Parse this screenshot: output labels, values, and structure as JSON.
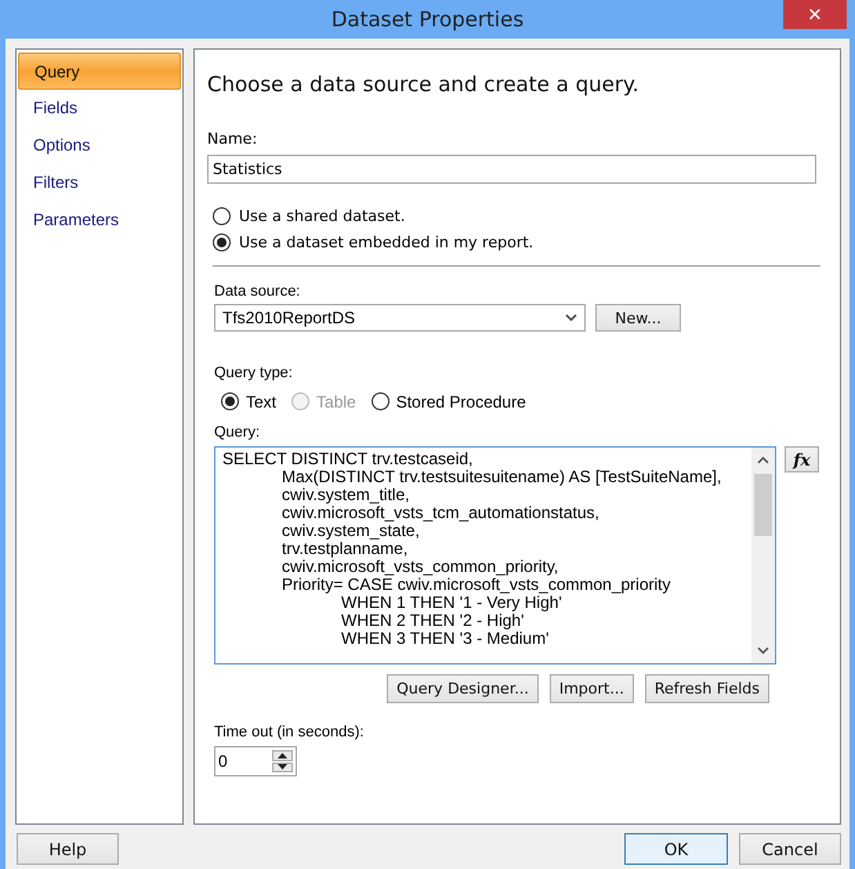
{
  "window": {
    "title": "Dataset Properties",
    "close": "✕"
  },
  "sidebar": {
    "items": [
      {
        "label": "Query",
        "selected": true
      },
      {
        "label": "Fields",
        "selected": false
      },
      {
        "label": "Options",
        "selected": false
      },
      {
        "label": "Filters",
        "selected": false
      },
      {
        "label": "Parameters",
        "selected": false
      }
    ]
  },
  "heading": "Choose a data source and create a query.",
  "name": {
    "label": "Name:",
    "value": "Statistics"
  },
  "dataset_options": [
    {
      "label": "Use a shared dataset.",
      "selected": false
    },
    {
      "label": "Use a dataset embedded in my report.",
      "selected": true
    }
  ],
  "data_source": {
    "label": "Data source:",
    "value": "Tfs2010ReportDS",
    "new_button": "New..."
  },
  "query_type": {
    "label": "Query type:",
    "options": [
      {
        "label": "Text",
        "selected": true,
        "disabled": false
      },
      {
        "label": "Table",
        "selected": false,
        "disabled": true
      },
      {
        "label": "Stored Procedure",
        "selected": false,
        "disabled": false
      }
    ]
  },
  "query": {
    "label": "Query:",
    "lines": [
      "SELECT DISTINCT trv.testcaseid,",
      "\tMax(DISTINCT trv.testsuitesuitename) AS [TestSuiteName],",
      "\tcwiv.system_title,",
      "\tcwiv.microsoft_vsts_tcm_automationstatus,",
      "\tcwiv.system_state,",
      "\ttrv.testplanname,",
      "\tcwiv.microsoft_vsts_common_priority,",
      "\tPriority= CASE cwiv.microsoft_vsts_common_priority",
      "\t\tWHEN 1 THEN '1 - Very High'",
      "\t\tWHEN 2 THEN '2 - High'",
      "\t\tWHEN 3 THEN '3 - Medium'"
    ],
    "fx_button": "fx"
  },
  "query_buttons": [
    "Query Designer...",
    "Import...",
    "Refresh Fields"
  ],
  "timeout": {
    "label": "Time out (in seconds):",
    "value": "0"
  },
  "footer": {
    "help": "Help",
    "ok": "OK",
    "cancel": "Cancel"
  }
}
